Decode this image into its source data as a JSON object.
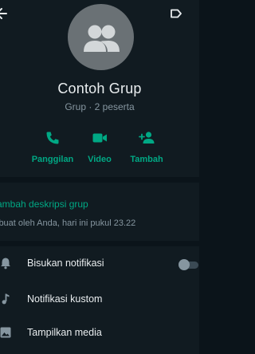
{
  "colors": {
    "background": "#0b141a",
    "card": "#111b21",
    "accent": "#00a884",
    "text_primary": "#e9edef",
    "text_secondary": "#8696a0",
    "avatar_bg": "#6a7175"
  },
  "header": {
    "back_icon": "arrow-back-icon",
    "more_icon": "label-icon"
  },
  "profile": {
    "avatar_icon": "group-avatar-icon",
    "name": "Contoh Grup",
    "subtitle": "Grup · 2 peserta"
  },
  "actions": [
    {
      "label": "Panggilan",
      "icon": "phone-icon"
    },
    {
      "label": "Video",
      "icon": "video-icon"
    },
    {
      "label": "Tambah",
      "icon": "add-person-icon"
    }
  ],
  "description": {
    "add_label": "ambah deskripsi grup",
    "created_text": "ibuat oleh Anda, hari ini pukul 23.22"
  },
  "settings": [
    {
      "label": "Bisukan notifikasi",
      "icon": "bell-icon",
      "toggle": false
    },
    {
      "label": "Notifikasi kustom",
      "icon": "music-note-icon"
    },
    {
      "label": "Tampilkan media",
      "icon": "image-icon"
    }
  ]
}
